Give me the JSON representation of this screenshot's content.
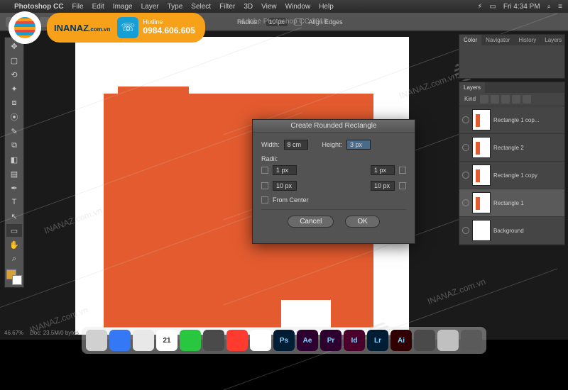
{
  "menubar": {
    "app": "Photoshop CC",
    "items": [
      "File",
      "Edit",
      "Image",
      "Layer",
      "Type",
      "Select",
      "Filter",
      "3D",
      "View",
      "Window",
      "Help"
    ],
    "clock": "Fri 4:34 PM"
  },
  "doc_title": "Adobe Photoshop CC 2018",
  "options": {
    "radius_label": "Radius:",
    "radius_value": "10 px",
    "align_edges": "Align Edges"
  },
  "dialog": {
    "title": "Create Rounded Rectangle",
    "width_label": "Width:",
    "width_value": "8 cm",
    "height_label": "Height:",
    "height_value": "3 px",
    "radii_label": "Radii:",
    "r_tl": "1 px",
    "r_tr": "1 px",
    "r_bl": "10 px",
    "r_br": "10 px",
    "from_center": "From Center",
    "cancel": "Cancel",
    "ok": "OK"
  },
  "panels": {
    "tabs_top": [
      "Color",
      "Navigator",
      "History",
      "Layers"
    ],
    "layers_tab": "Layers",
    "blend_mode": "Kind",
    "layers": [
      {
        "name": "Rectangle 1 cop..."
      },
      {
        "name": "Rectangle 2"
      },
      {
        "name": "Rectangle 1 copy"
      },
      {
        "name": "Rectangle 1"
      },
      {
        "name": "Background"
      }
    ]
  },
  "status": {
    "zoom": "46.67%",
    "info": "Doc: 23.5M/0 bytes"
  },
  "brand": {
    "name": "INANAZ",
    "suffix": ".com.vn",
    "hotline_label": "Hotline",
    "hotline_number": "0984.606.605"
  },
  "watermark": "INANAZ.com.vn",
  "dock": [
    {
      "bg": "#d0d0d0",
      "txt": ""
    },
    {
      "bg": "#3478f6",
      "txt": ""
    },
    {
      "bg": "#e8e8e8",
      "txt": ""
    },
    {
      "bg": "#ffffff",
      "txt": "21"
    },
    {
      "bg": "#29c740",
      "txt": ""
    },
    {
      "bg": "#4a4a4a",
      "txt": ""
    },
    {
      "bg": "#ff3b30",
      "txt": ""
    },
    {
      "bg": "#ffffff",
      "txt": ""
    },
    {
      "bg": "#001d34",
      "txt": "Ps"
    },
    {
      "bg": "#2d0030",
      "txt": "Ae"
    },
    {
      "bg": "#2d0030",
      "txt": "Pr"
    },
    {
      "bg": "#4b002b",
      "txt": "Id"
    },
    {
      "bg": "#001d34",
      "txt": "Lr"
    },
    {
      "bg": "#310000",
      "txt": "Ai"
    },
    {
      "bg": "#4a4a4a",
      "txt": ""
    },
    {
      "bg": "#c0c0c0",
      "txt": ""
    },
    {
      "bg": "#5a5a5a",
      "txt": ""
    }
  ]
}
